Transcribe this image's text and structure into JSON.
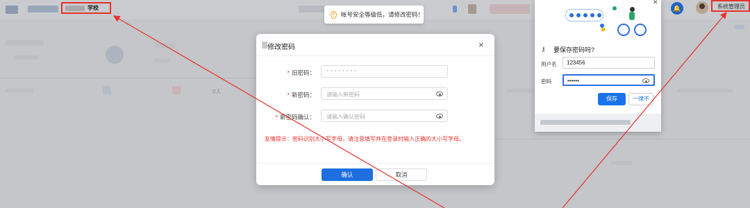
{
  "header": {
    "school_name": "学校",
    "admin_label": "系统管理员"
  },
  "toast": {
    "message": "帐号安全等级低，请修改密码！"
  },
  "modal": {
    "title": "修改密码",
    "close_symbol": "×",
    "fields": [
      {
        "label": "旧密码：",
        "required": "*",
        "value": "········",
        "placeholder": ""
      },
      {
        "label": "新密码：",
        "required": "*",
        "value": "",
        "placeholder": "请输入新密码"
      },
      {
        "label": "新密码确认：",
        "required": "*",
        "value": "",
        "placeholder": "请输入确认密码"
      }
    ],
    "tip": "友情提示：密码识别大小写字母，请注意填写并在登录时输入正确的大小写字母。",
    "confirm_label": "确认",
    "cancel_label": "取消"
  },
  "password_popup": {
    "title": "要保存密码吗?",
    "username_label": "用户名",
    "username_value": "123456",
    "password_label": "密码",
    "password_value": "••••••",
    "save_label": "保存",
    "never_label": "一律不"
  },
  "background": {
    "count_text": "0人"
  },
  "colors": {
    "primary": "#1e6fe0",
    "annotation": "#e5312d",
    "warning": "#f0a020"
  }
}
